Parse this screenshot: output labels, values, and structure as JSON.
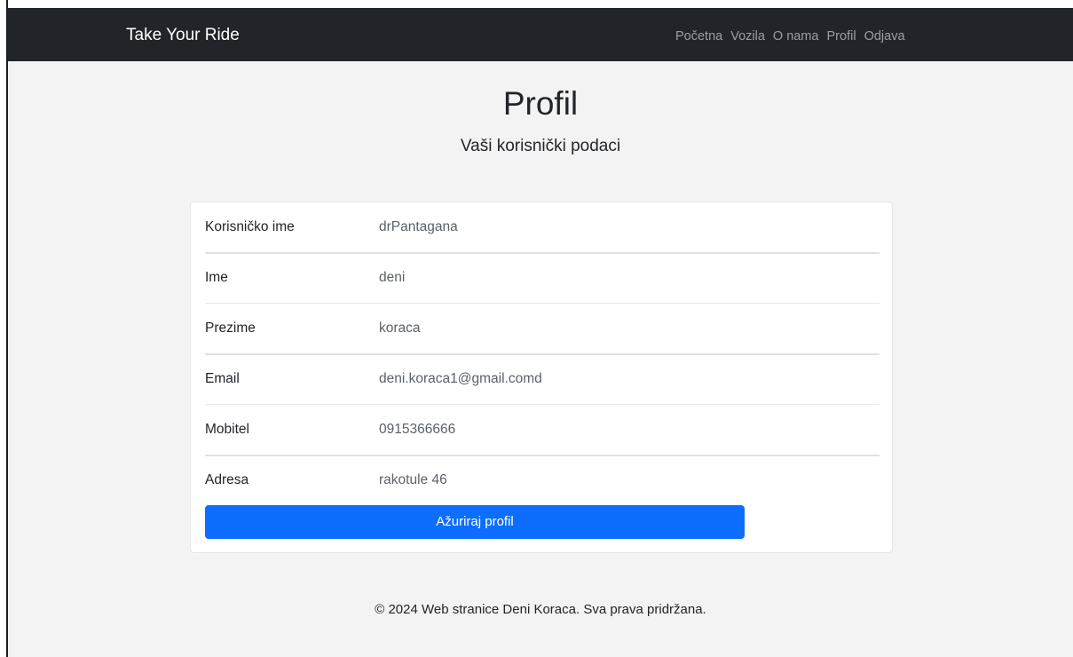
{
  "navbar": {
    "brand": "Take Your Ride",
    "links": [
      {
        "label": "Početna"
      },
      {
        "label": "Vozila"
      },
      {
        "label": "O nama"
      },
      {
        "label": "Profil"
      },
      {
        "label": "Odjava"
      }
    ]
  },
  "header": {
    "title": "Profil",
    "subtitle": "Vaši korisnički podaci"
  },
  "profile": {
    "rows": [
      {
        "label": "Korisničko ime",
        "value": "drPantagana"
      },
      {
        "label": "Ime",
        "value": "deni"
      },
      {
        "label": "Prezime",
        "value": "koraca"
      },
      {
        "label": "Email",
        "value": "deni.koraca1@gmail.comd"
      },
      {
        "label": "Mobitel",
        "value": "0915366666"
      },
      {
        "label": "Adresa",
        "value": "rakotule 46"
      }
    ],
    "update_button_label": "Ažuriraj profil"
  },
  "footer": {
    "text": "© 2024 Web stranice Deni Koraca. Sva prava pridržana."
  },
  "colors": {
    "navbar_bg": "#212529",
    "page_bg": "#f3f3f3",
    "primary_button": "#0d6efd"
  }
}
